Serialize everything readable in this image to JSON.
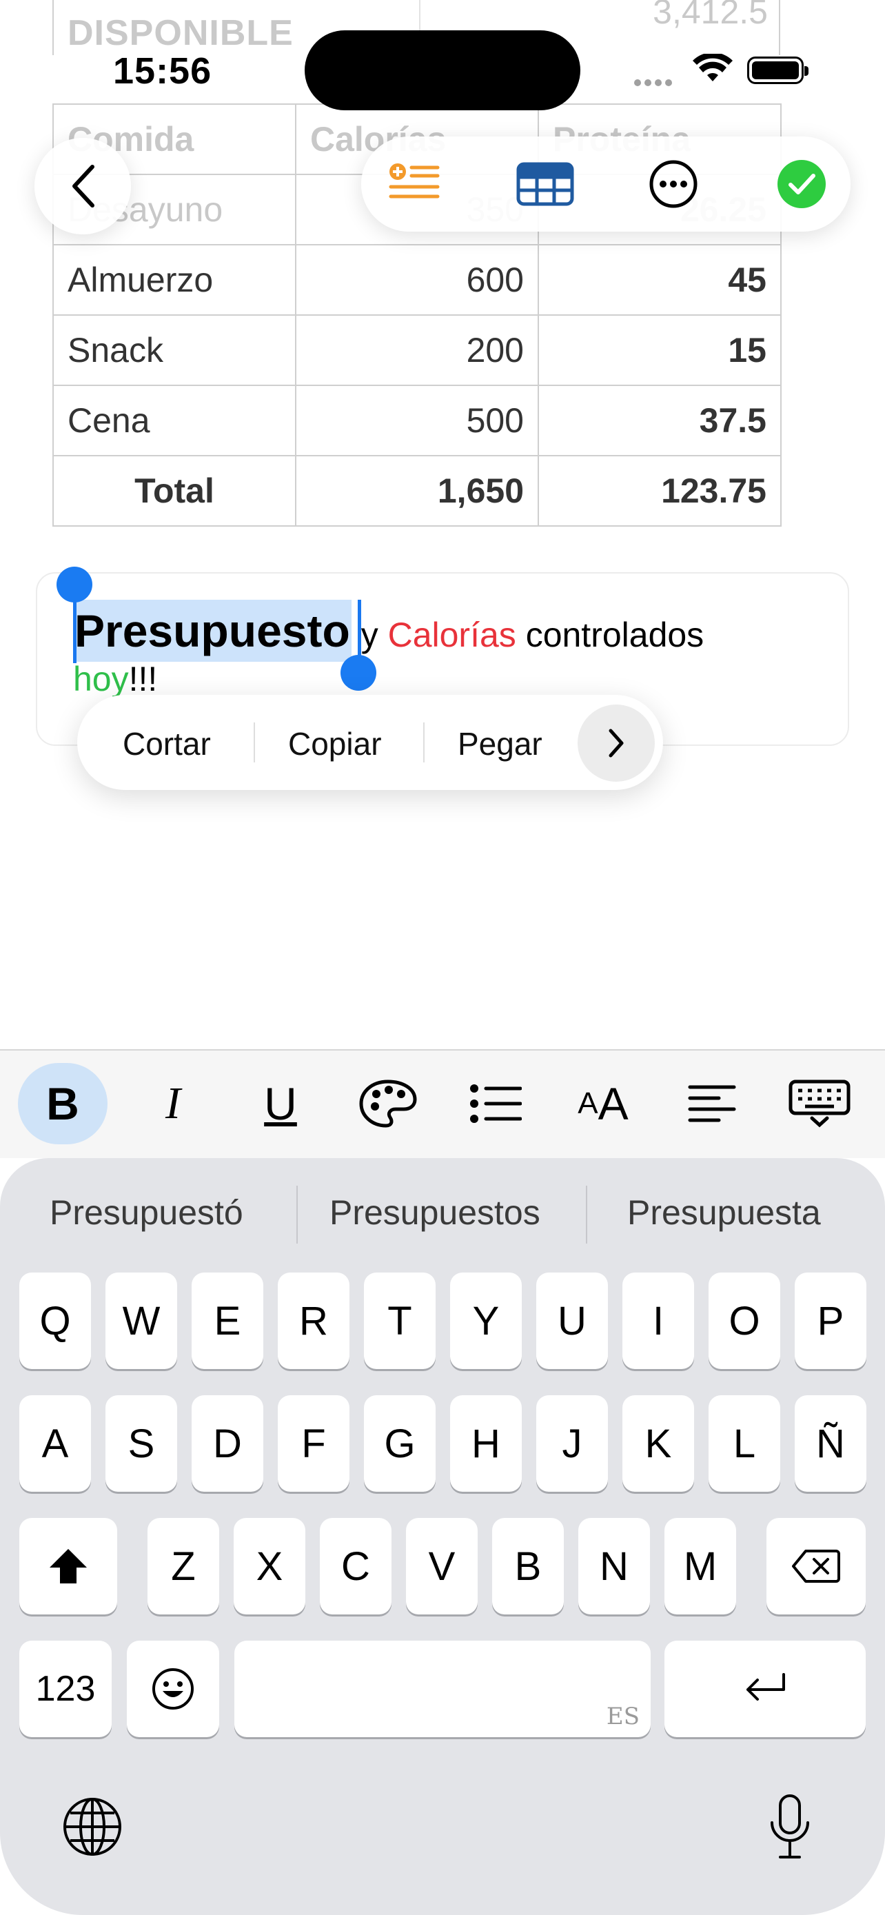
{
  "status_bar": {
    "time": "15:56"
  },
  "table": {
    "top_row": {
      "label": "DISPONIBLE",
      "value": "3,412.5"
    },
    "headers": [
      "Comida",
      "Calorías",
      "Proteína"
    ],
    "rows": [
      {
        "meal": "Desayuno",
        "calories": "350",
        "protein": "26.25"
      },
      {
        "meal": "Almuerzo",
        "calories": "600",
        "protein": "45"
      },
      {
        "meal": "Snack",
        "calories": "200",
        "protein": "15"
      },
      {
        "meal": "Cena",
        "calories": "500",
        "protein": "37.5"
      }
    ],
    "total": {
      "label": "Total",
      "calories": "1,650",
      "protein": "123.75"
    }
  },
  "note_text": {
    "selected_word": "Presupuesto",
    "word_y": "y",
    "calorias": "Calorías",
    "controlados": "controlados",
    "hoy": "hoy",
    "exclaim": "!!!"
  },
  "edit_menu": {
    "cut": "Cortar",
    "copy": "Copiar",
    "paste": "Pegar"
  },
  "format_toolbar": {
    "bold": "B",
    "italic": "I",
    "underline": "U",
    "textsize": "AA"
  },
  "suggestions": [
    "Presupuestó",
    "Presupuestos",
    "Presupuesta"
  ],
  "keyboard": {
    "row1": [
      "Q",
      "W",
      "E",
      "R",
      "T",
      "Y",
      "U",
      "I",
      "O",
      "P"
    ],
    "row2": [
      "A",
      "S",
      "D",
      "F",
      "G",
      "H",
      "J",
      "K",
      "L",
      "Ñ"
    ],
    "row3": [
      "Z",
      "X",
      "C",
      "V",
      "B",
      "N",
      "M"
    ],
    "numbers": "123",
    "space_lang": "ES"
  },
  "colors": {
    "accent": "#1a7bf2",
    "selection": "#cde3fb",
    "red_text": "#e8323a",
    "green_text": "#2fbf4a",
    "done": "#2ecc40",
    "orange_icon": "#f39a2b",
    "table_icon": "#1f5aa0"
  }
}
